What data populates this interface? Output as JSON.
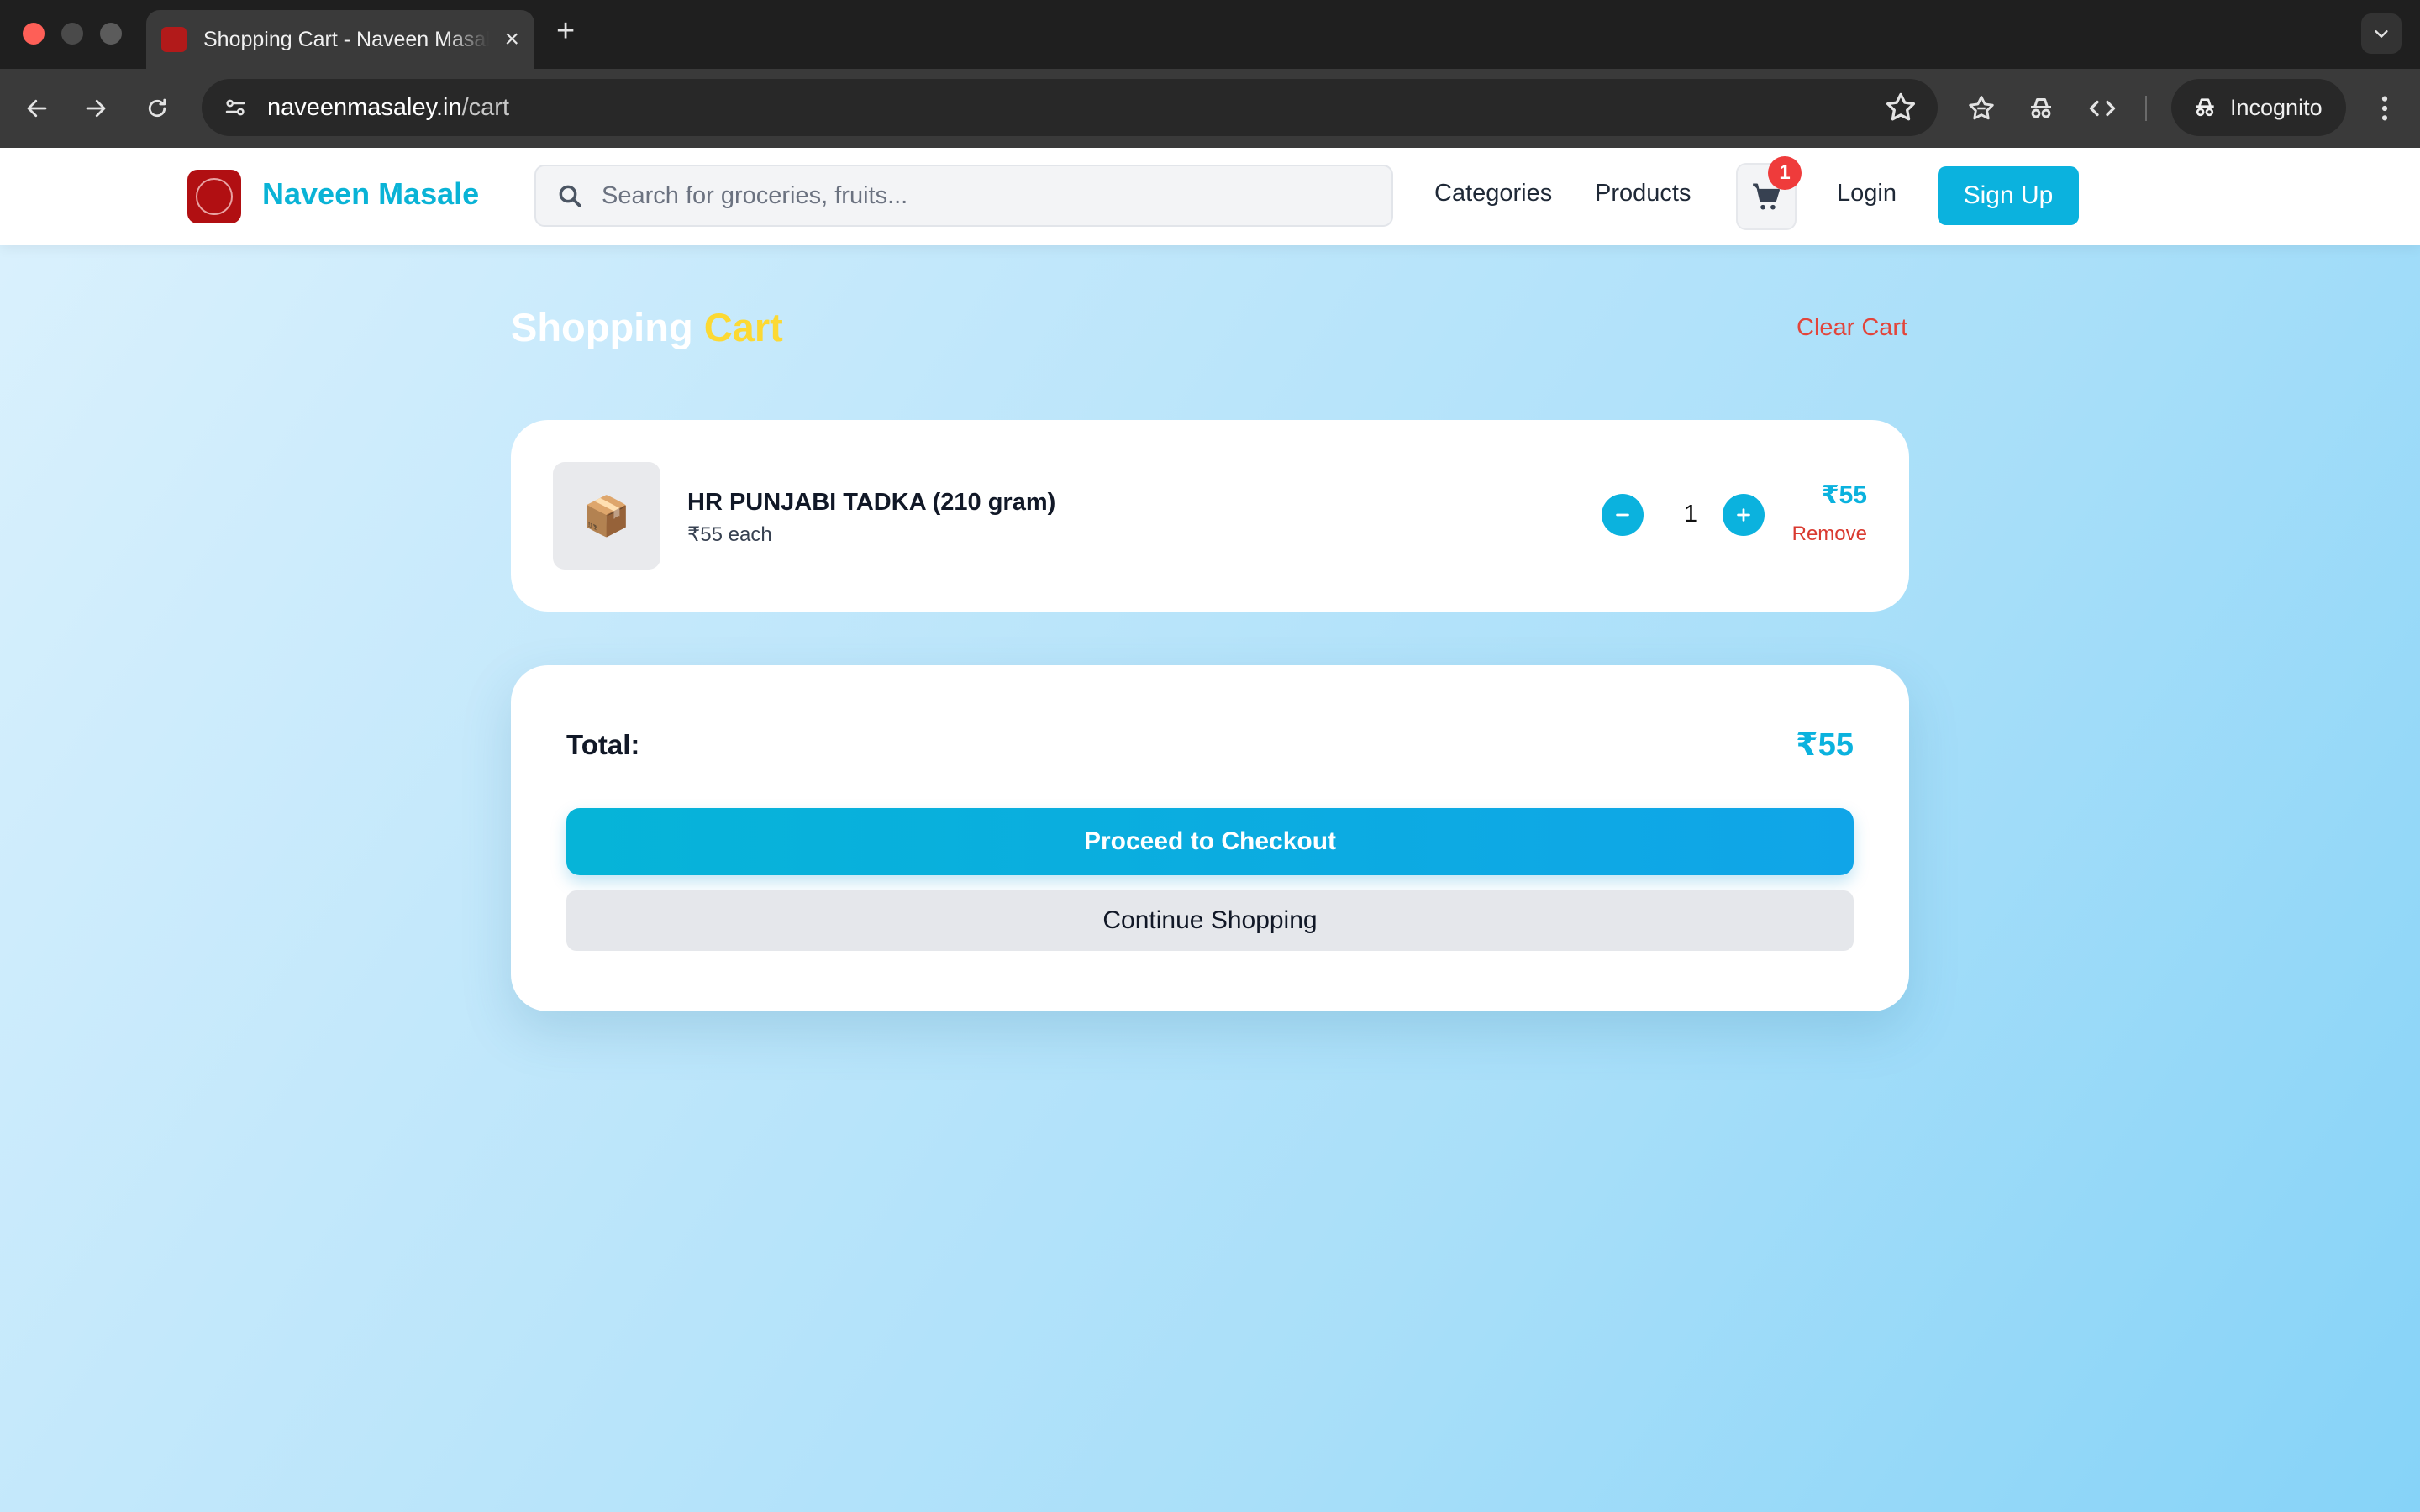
{
  "browser": {
    "tab_title": "Shopping Cart - Naveen Masale",
    "new_tab": "+",
    "tab_close": "×",
    "url_host": "naveenmasaley.in",
    "url_path": "/cart",
    "incognito_label": "Incognito"
  },
  "header": {
    "brand": "Naveen Masale",
    "search_placeholder": "Search for groceries, fruits...",
    "nav": [
      "Categories",
      "Products"
    ],
    "cart_count": "1",
    "login": "Login",
    "signup": "Sign Up"
  },
  "cart": {
    "title_part1": "Shopping",
    "title_part2": "Cart",
    "clear_label": "Clear Cart",
    "items": [
      {
        "icon": "📦",
        "name": "HR PUNJABI TADKA (210 gram)",
        "each": "₹55 each",
        "quantity": "1",
        "line_total": "₹55",
        "remove_label": "Remove"
      }
    ],
    "total_label": "Total:",
    "total_value": "₹55",
    "checkout_label": "Proceed to Checkout",
    "continue_label": "Continue Shopping"
  },
  "colors": {
    "accent": "#0bb2de",
    "title_highlight": "#fcd933",
    "danger": "#e2453b",
    "badge": "#ef3b3b"
  }
}
